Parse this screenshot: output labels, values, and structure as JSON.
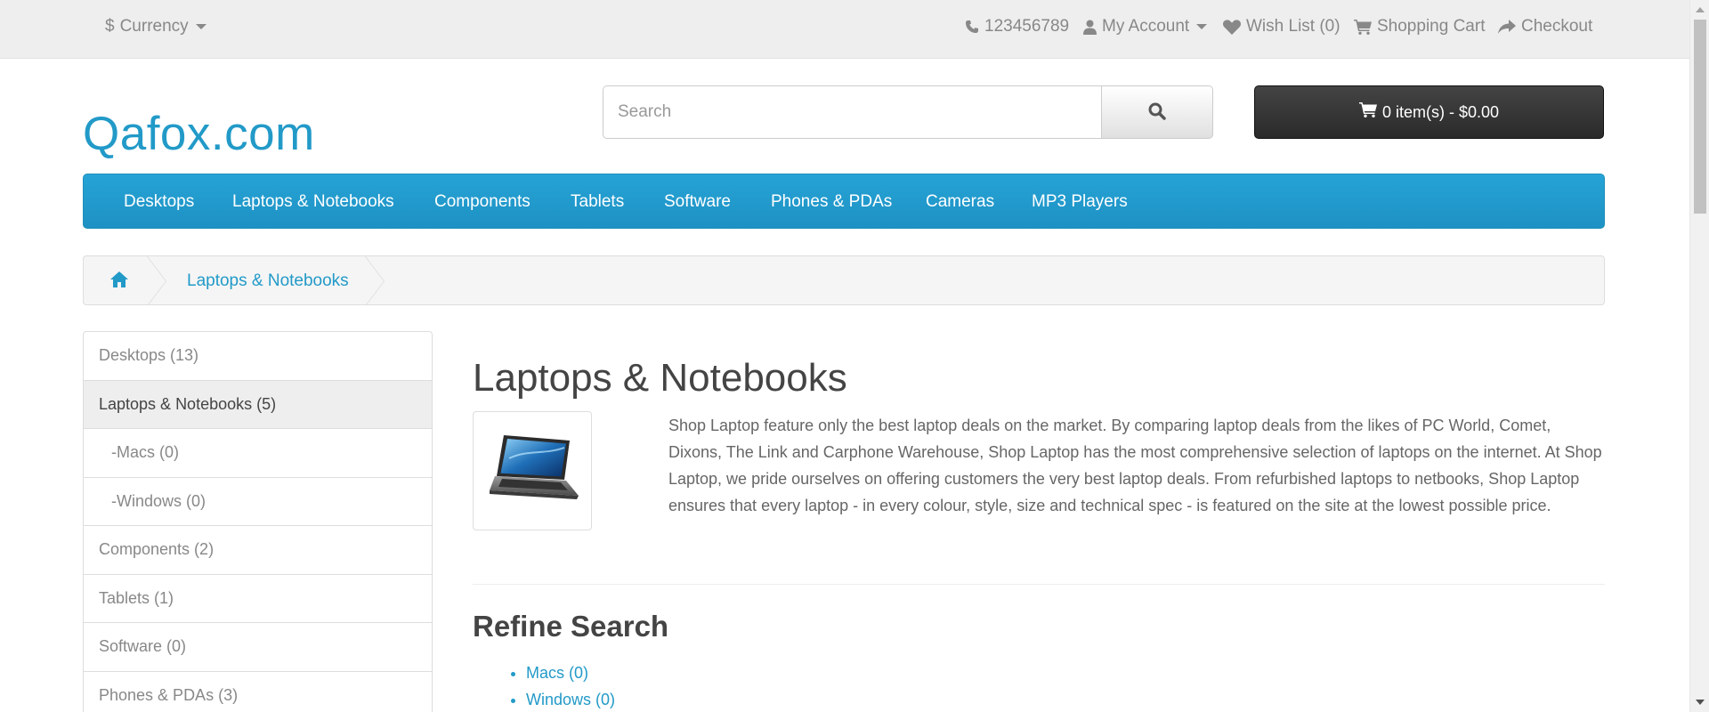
{
  "topbar": {
    "currency": "Currency",
    "phone": "123456789",
    "my_account": "My Account",
    "wish_list": "Wish List (0)",
    "shopping_cart": "Shopping Cart",
    "checkout": "Checkout"
  },
  "header": {
    "logo": "Qafox.com",
    "search_placeholder": "Search",
    "cart_button": "0 item(s) - $0.00"
  },
  "menu": {
    "items": [
      "Desktops",
      "Laptops & Notebooks",
      "Components",
      "Tablets",
      "Software",
      "Phones & PDAs",
      "Cameras",
      "MP3 Players"
    ]
  },
  "breadcrumb": {
    "current": "Laptops & Notebooks"
  },
  "sidebar": {
    "items": [
      {
        "label": "Desktops (13)"
      },
      {
        "label": "Laptops & Notebooks (5)"
      },
      {
        "label": "-Macs (0)"
      },
      {
        "label": "-Windows (0)"
      },
      {
        "label": "Components (2)"
      },
      {
        "label": "Tablets (1)"
      },
      {
        "label": "Software (0)"
      },
      {
        "label": "Phones & PDAs (3)"
      }
    ]
  },
  "content": {
    "title": "Laptops & Notebooks",
    "description": "Shop Laptop feature only the best laptop deals on the market. By comparing laptop deals from the likes of PC World, Comet, Dixons, The Link and Carphone Warehouse, Shop Laptop has the most comprehensive selection of laptops on the internet. At Shop Laptop, we pride ourselves on offering customers the very best laptop deals. From refurbished laptops to netbooks, Shop Laptop ensures that every laptop - in every colour, style, size and technical spec - is featured on the site at the lowest possible price.",
    "refine_title": "Refine Search",
    "refine_links": [
      "Macs (0)",
      "Windows (0)"
    ]
  },
  "colors": {
    "brand_blue": "#229ac8",
    "cart_dark": "#333333"
  }
}
